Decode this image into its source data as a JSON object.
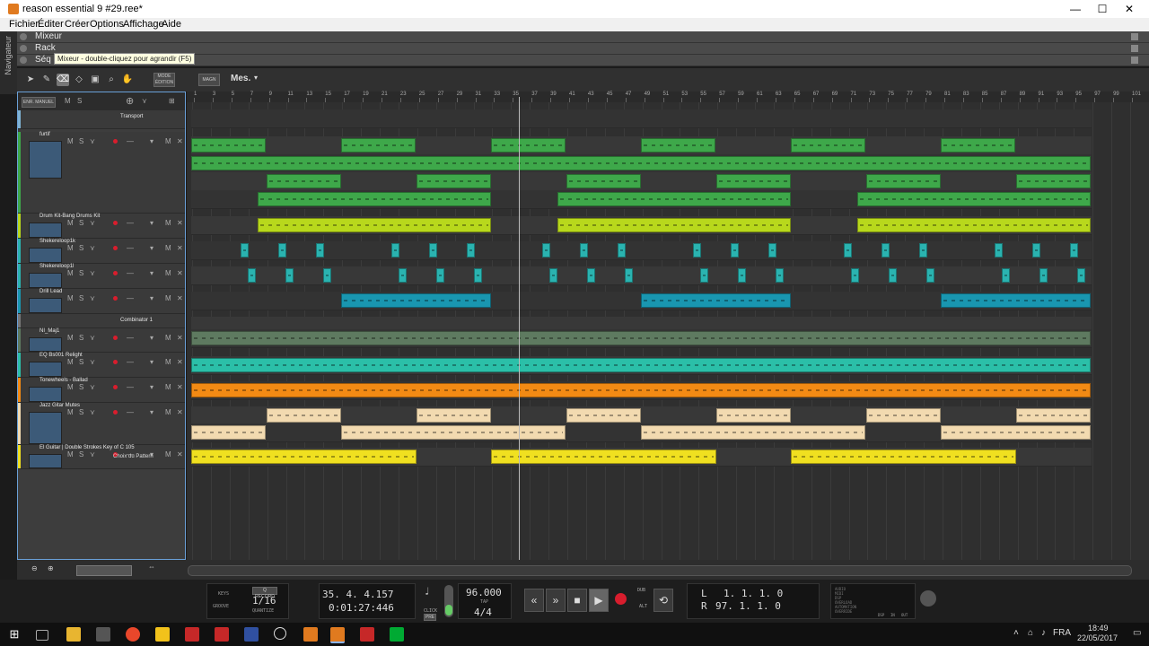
{
  "window": {
    "title": "reason essential 9 #29.ree*",
    "min": "—",
    "max": "☐",
    "close": "✕"
  },
  "menu": [
    "Fichier",
    "Éditer",
    "Créer",
    "Options",
    "Affichage",
    "Aide"
  ],
  "navigator": {
    "label": "Navigateur",
    "rows": [
      "Mixeur",
      "Rack",
      "Séq"
    ],
    "tooltip": "Mixeur - double-cliquez pour agrandir (F5)"
  },
  "toolbar": {
    "mode_edition": "MODE ÉDITION",
    "magn": "MAGN",
    "snap": "Mes."
  },
  "track_header": {
    "enr_manuel": "ENR. MANUEL",
    "m": "M",
    "s": "S"
  },
  "tracks": [
    {
      "name": "Transport",
      "color": "#7fb3d5"
    },
    {
      "name": "furtif",
      "color": "#3ea84a"
    },
    {
      "name": "Drum Kit-Bang Drums Kit",
      "color": "#b8d81c"
    },
    {
      "name": "Shekereloop1k",
      "color": "#2ab3b0"
    },
    {
      "name": "Shekereloop1l",
      "color": "#2ab3b0"
    },
    {
      "name": "Drill Lead",
      "color": "#1996b0"
    },
    {
      "name": "Combinator 1",
      "color": "#777777"
    },
    {
      "name": "NI_Maj1",
      "color": "#5e7a60"
    },
    {
      "name": "EQ Bs001 Relight",
      "color": "#2bbfa8"
    },
    {
      "name": "Tonewheels - Ballad",
      "color": "#f28a14"
    },
    {
      "name": "Jazz Gitar Mutes",
      "color": "#f2dab0"
    },
    {
      "name": "El Guitar | Double Strokes Key of C 105",
      "color": "#f0e020"
    }
  ],
  "pattern_label": "Choix du Pattern",
  "ruler_marks": [
    "1",
    "3",
    "5",
    "7",
    "9",
    "11",
    "13",
    "15",
    "17",
    "19",
    "21",
    "23",
    "25",
    "27",
    "29",
    "31",
    "33",
    "35",
    "37",
    "39",
    "41",
    "43",
    "45",
    "47",
    "49",
    "51",
    "53",
    "55",
    "57",
    "59",
    "61",
    "63",
    "65",
    "67",
    "69",
    "71",
    "73",
    "75",
    "77",
    "79",
    "81",
    "83",
    "85",
    "87",
    "89",
    "91",
    "93",
    "95",
    "97",
    "99",
    "101"
  ],
  "transport": {
    "keys": "KEYS",
    "groove": "GROOVE",
    "q_record": "Q RECORD",
    "quantize_value": "1/16",
    "quantize": "QUANTIZE",
    "position_bars": "35.  4.  4.157",
    "position_time": "0:01:27:446",
    "click": "CLICK",
    "pre": "PRE",
    "tempo": "96.000",
    "tap": "TAP",
    "signature": "4/4",
    "dub": "DUB",
    "alt": "ALT",
    "loop_l_label": "L",
    "loop_l_value": "1.  1.  1.     0",
    "loop_r_label": "R",
    "loop_r_value": "97.  1.  1.     0",
    "status_lines": [
      "AUDIO",
      "MIDI",
      "DSP",
      "OVERLOAD",
      "AUTOMATION",
      "OVERRIDE"
    ],
    "dsp": "DSP",
    "in": "IN",
    "out": "OUT"
  },
  "taskbar": {
    "lang": "FRA",
    "time": "18:49",
    "date": "22/05/2017"
  }
}
